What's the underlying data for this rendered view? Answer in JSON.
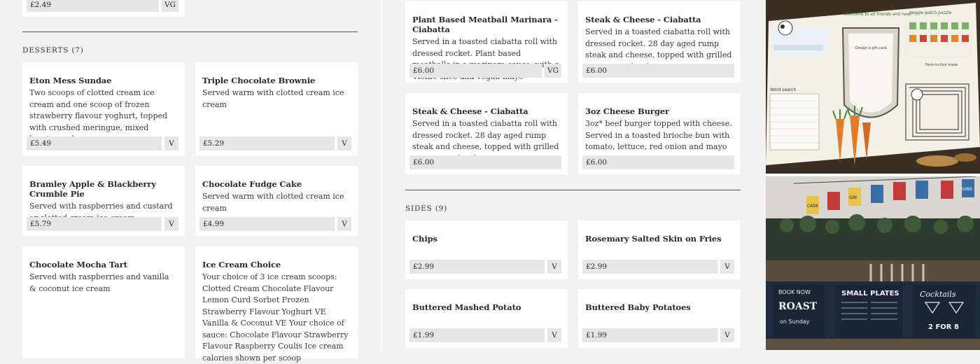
{
  "left": {
    "top_partial": {
      "price": "£2.49",
      "tag": "VG"
    },
    "desserts_title": "DESSERTS (7)",
    "desserts": [
      {
        "name": "Eton Mess Sundae",
        "desc": "Two scoops of clotted cream ice cream and one scoop of frozen strawberry flavour yoghurt, topped with crushed meringue, mixed berries and cream",
        "price": "£5.49",
        "tag": "V"
      },
      {
        "name": "Triple Chocolate Brownie",
        "desc": "Served warm with clotted cream ice cream",
        "price": "£5.29",
        "tag": "V"
      },
      {
        "name": "Bramley Apple & Blackberry Crumble Pie",
        "desc": "Served with raspberries and custard or clotted cream ice cream",
        "price": "£5.79",
        "tag": "V"
      },
      {
        "name": "Chocolate Fudge Cake",
        "desc": "Served warm with clotted cream ice cream",
        "price": "£4.99",
        "tag": "V"
      },
      {
        "name": "Chocolate Mocha Tart",
        "desc": "Served with raspberries and vanilla & coconut ice cream"
      },
      {
        "name": "Ice Cream Choice",
        "desc": "Your choice of 3 ice cream scoops: Clotted Cream Chocolate Flavour Lemon Curd Sorbet Frozen Strawberry Flavour Yoghurt VE Vanilla & Coconut VE Your choice of sauce: Chocolate Flavour Strawberry Flavour Raspberry Coulis Ice cream calories shown per scoop"
      }
    ]
  },
  "middle": {
    "sandwiches": [
      {
        "name": "Plant Based Meatball Marinara - Ciabatta",
        "desc": "Served in a toasted ciabatta roll with dressed rocket. Plant based meatballs in a marinara sauce, with a Violife slice and vegan mayo",
        "price": "£6.00",
        "tag": "VG"
      },
      {
        "name": "Steak & Cheese - Ciabatta",
        "desc": "Served in a toasted ciabatta roll with dressed rocket. 28 day aged rump steak and cheese, topped with grilled peppers and red onions",
        "price": "£6.00"
      },
      {
        "name": "Steak & Cheese - Ciabatta",
        "desc": "Served in a toasted ciabatta roll with dressed rocket. 28 day aged rump steak and cheese, topped with grilled peppers and red onions",
        "price": "£6.00"
      },
      {
        "name": "3oz Cheese Burger",
        "desc": "3oz* beef burger topped with cheese. Served in a toasted brioche bun with tomato, lettuce, red onion and mayo",
        "price": "£6.00"
      }
    ],
    "sides_title": "SIDES (9)",
    "sides": [
      {
        "name": "Chips",
        "price": "£2.99",
        "tag": "V"
      },
      {
        "name": "Rosemary Salted Skin on Fries",
        "price": "£2.99",
        "tag": "V"
      },
      {
        "name": "Buttered Mashed Potato",
        "price": "£1.99",
        "tag": "V"
      },
      {
        "name": "Buttered Baby Potatoes",
        "price": "£1.99",
        "tag": "V"
      }
    ]
  },
  "photos": {
    "top": {
      "welcome": "Welcome to all friends and new!",
      "patch": "Veggie patch puzzle",
      "design": "Design a gift card",
      "word_search": "Word search",
      "maze": "Farm-to-fork maze"
    },
    "bottom": {
      "board1": "BOOK NOW",
      "board1b": "ROAST",
      "board1c": "on Sunday",
      "board2": "SMALL PLATES",
      "board3": "Cocktails",
      "board3b": "2 FOR 8",
      "flags": [
        "CASK",
        "GIN",
        "GINS"
      ]
    }
  }
}
